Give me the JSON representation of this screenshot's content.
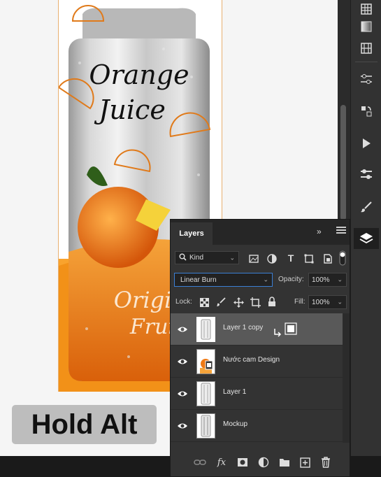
{
  "image": {
    "heading_line1": "Orange",
    "heading_line2": "Juice",
    "footer_line1": "Original",
    "footer_line2": "Fruit"
  },
  "overlay": {
    "caption": "Hold Alt"
  },
  "toolbar": {
    "tools": [
      "table-icon",
      "gradient-square-icon",
      "grid-icon",
      "sliders-icon",
      "transfer-icon",
      "play-icon",
      "toggle-icon",
      "brush-icon",
      "layers-icon"
    ]
  },
  "layers_panel": {
    "title": "Layers",
    "filter_kind": "Kind",
    "blend_mode": "Linear Burn",
    "opacity_label": "Opacity:",
    "opacity_value": "100%",
    "lock_label": "Lock:",
    "fill_label": "Fill:",
    "fill_value": "100%",
    "layers": [
      {
        "name": "Layer 1 copy",
        "selected": true
      },
      {
        "name": "Nước cam Design",
        "selected": false
      },
      {
        "name": "Layer 1",
        "selected": false
      },
      {
        "name": "Mockup",
        "selected": false
      }
    ],
    "footer_icons": [
      "link-icon",
      "fx-icon",
      "mask-icon",
      "adjustment-icon",
      "folder-icon",
      "new-layer-icon",
      "trash-icon"
    ]
  },
  "colors": {
    "orange": "#f07a14",
    "accent": "#3b7fd4",
    "panel": "#333333"
  }
}
